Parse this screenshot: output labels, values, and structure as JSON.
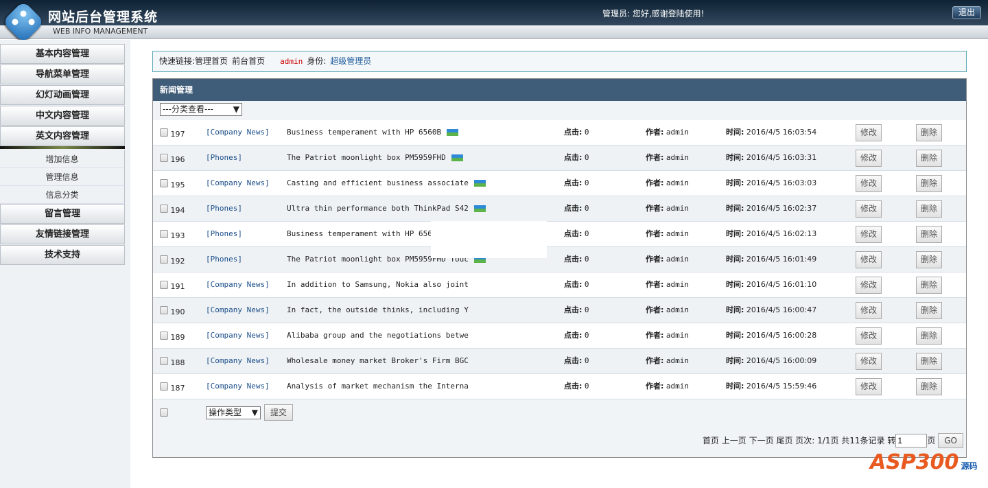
{
  "header": {
    "title": "网站后台管理系统",
    "subtitle": "WEB INFO MANAGEMENT",
    "greeting": "管理员: 您好,感谢登陆使用!",
    "logout": "退出"
  },
  "sidebar": {
    "menus": [
      "基本内容管理",
      "导航菜单管理",
      "幻灯动画管理",
      "中文内容管理",
      "英文内容管理"
    ],
    "sub_items": [
      "增加信息",
      "管理信息",
      "信息分类"
    ],
    "menus_after": [
      "留言管理",
      "友情链接管理",
      "技术支持"
    ]
  },
  "quick": {
    "label": "快速链接:",
    "home": "管理首页",
    "front": "前台首页",
    "user": "admin",
    "role_label": "身份:",
    "role": "超级管理员"
  },
  "panel": {
    "title": "新闻管理",
    "filter": "---分类查看---",
    "clicks_label": "点击:",
    "author_label": "作者:",
    "time_label": "时间:",
    "edit": "修改",
    "delete": "删除",
    "rows": [
      {
        "id": "197",
        "cat": "[Company News]",
        "title": "Business temperament with HP 6560B",
        "pic": true,
        "clicks": "0",
        "author": "admin",
        "time": "2016/4/5 16:03:54"
      },
      {
        "id": "196",
        "cat": "[Phones]",
        "title": "The Patriot moonlight box PM5959FHD",
        "pic": true,
        "clicks": "0",
        "author": "admin",
        "time": "2016/4/5 16:03:31"
      },
      {
        "id": "195",
        "cat": "[Company News]",
        "title": "Casting and efficient business associate",
        "pic": true,
        "clicks": "0",
        "author": "admin",
        "time": "2016/4/5 16:03:03"
      },
      {
        "id": "194",
        "cat": "[Phones]",
        "title": "Ultra thin performance both ThinkPad S42",
        "pic": true,
        "clicks": "0",
        "author": "admin",
        "time": "2016/4/5 16:02:37"
      },
      {
        "id": "193",
        "cat": "[Phones]",
        "title": "Business temperament with HP 6560B",
        "pic": false,
        "clicks": "0",
        "author": "admin",
        "time": "2016/4/5 16:02:13"
      },
      {
        "id": "192",
        "cat": "[Phones]",
        "title": "The Patriot moonlight box PM5959FHD Touc",
        "pic": true,
        "clicks": "0",
        "author": "admin",
        "time": "2016/4/5 16:01:49"
      },
      {
        "id": "191",
        "cat": "[Company News]",
        "title": "In addition to Samsung, Nokia also joint",
        "pic": false,
        "clicks": "0",
        "author": "admin",
        "time": "2016/4/5 16:01:10"
      },
      {
        "id": "190",
        "cat": "[Company News]",
        "title": "In fact, the outside thinks, including Y",
        "pic": false,
        "clicks": "0",
        "author": "admin",
        "time": "2016/4/5 16:00:47"
      },
      {
        "id": "189",
        "cat": "[Company News]",
        "title": "Alibaba group and the negotiations betwe",
        "pic": false,
        "clicks": "0",
        "author": "admin",
        "time": "2016/4/5 16:00:28"
      },
      {
        "id": "188",
        "cat": "[Company News]",
        "title": "Wholesale money market Broker's Firm BGC",
        "pic": false,
        "clicks": "0",
        "author": "admin",
        "time": "2016/4/5 16:00:09"
      },
      {
        "id": "187",
        "cat": "[Company News]",
        "title": "Analysis of market mechanism the Interna",
        "pic": false,
        "clicks": "0",
        "author": "admin",
        "time": "2016/4/5 15:59:46"
      }
    ],
    "action_type": "操作类型",
    "submit": "提交"
  },
  "pager": {
    "first": "首页",
    "prev": "上一页",
    "next": "下一页",
    "last": "尾页",
    "pages": "页次: 1/1页",
    "total": "共11条记录",
    "goto": "转",
    "page_value": "1",
    "page_suffix": "页",
    "go": "GO"
  },
  "watermark": {
    "text": "ASP300",
    "sub": "源码 .com"
  }
}
